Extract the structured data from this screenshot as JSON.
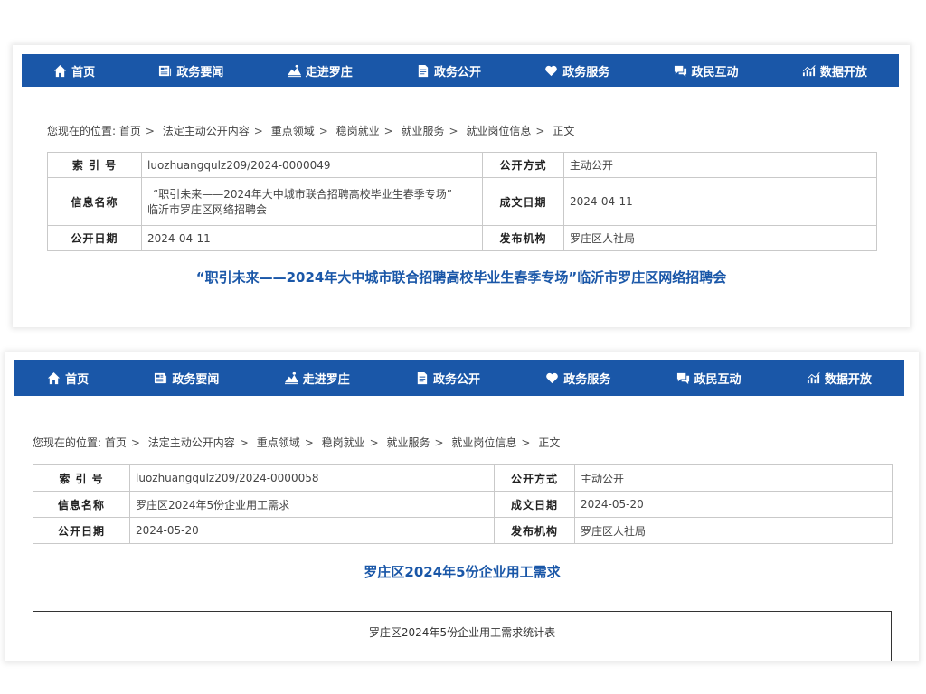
{
  "nav": {
    "items": [
      {
        "label": "首页",
        "icon": "home-icon"
      },
      {
        "label": "政务要闻",
        "icon": "newspaper-icon"
      },
      {
        "label": "走进罗庄",
        "icon": "landscape-icon"
      },
      {
        "label": "政务公开",
        "icon": "document-icon"
      },
      {
        "label": "政务服务",
        "icon": "heart-icon"
      },
      {
        "label": "政民互动",
        "icon": "chat-icon"
      },
      {
        "label": "数据开放",
        "icon": "chart-icon"
      }
    ]
  },
  "breadcrumb": {
    "prefix": "您现在的位置:",
    "items": [
      "首页",
      "法定主动公开内容",
      "重点领域",
      "稳岗就业",
      "就业服务",
      "就业岗位信息",
      "正文"
    ]
  },
  "labels": {
    "index": "索 引 号",
    "info_name": "信息名称",
    "publish_date": "公开日期",
    "method": "公开方式",
    "written_date": "成文日期",
    "agency": "发布机构"
  },
  "card1": {
    "index_no": "luozhuangqulz209/2024-0000049",
    "info_name_line1": "“职引未来——2024年大中城市联合招聘高校毕业生春季专场”",
    "info_name_line2": "临沂市罗庄区网络招聘会",
    "publish_date": "2024-04-11",
    "method": "主动公开",
    "written_date": "2024-04-11",
    "agency": "罗庄区人社局",
    "title": "“职引未来——2024年大中城市联合招聘高校毕业生春季专场”临沂市罗庄区网络招聘会"
  },
  "card2": {
    "index_no": "luozhuangqulz209/2024-0000058",
    "info_name": "罗庄区2024年5份企业用工需求",
    "publish_date": "2024-05-20",
    "method": "主动公开",
    "written_date": "2024-05-20",
    "agency": "罗庄区人社局",
    "title": "罗庄区2024年5份企业用工需求",
    "table_title": "罗庄区2024年5份企业用工需求统计表"
  }
}
